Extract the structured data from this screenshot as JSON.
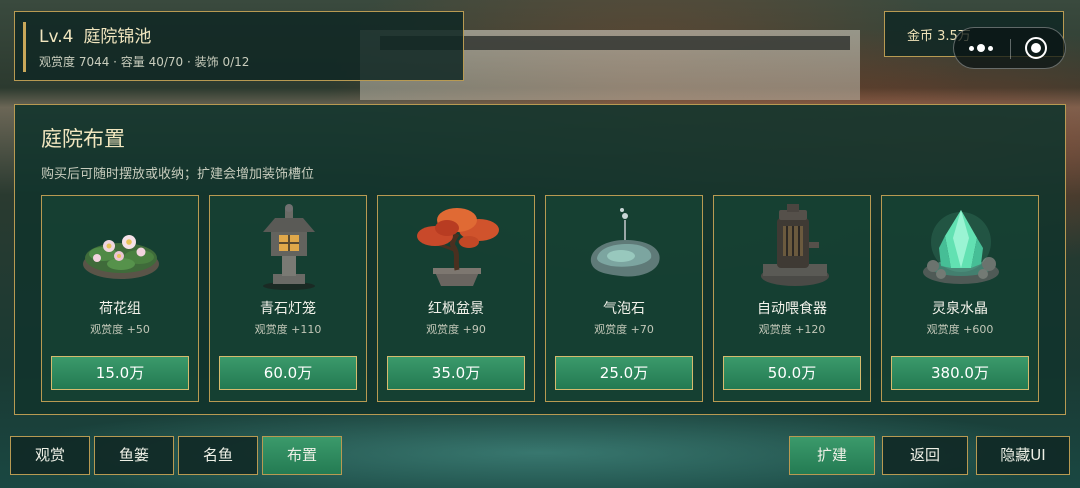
{
  "header": {
    "level": "Lv.4",
    "name": "庭院锦池",
    "stats": "观赏度 7044 · 容量 40/70 · 装饰 0/12"
  },
  "coins": {
    "text": "金币 3.5万"
  },
  "capsule": {
    "more_icon": "more-dots-icon",
    "close_icon": "target-circle-icon"
  },
  "panel": {
    "title": "庭院布置",
    "subtitle": "购买后可随时摆放或收纳；扩建会增加装饰槽位"
  },
  "items": [
    {
      "name": "荷花组",
      "bonus": "观赏度 +50",
      "price": "15.0万",
      "icon": "lotus-cluster-icon"
    },
    {
      "name": "青石灯笼",
      "bonus": "观赏度 +110",
      "price": "60.0万",
      "icon": "stone-lantern-icon"
    },
    {
      "name": "红枫盆景",
      "bonus": "观赏度 +90",
      "price": "35.0万",
      "icon": "maple-bonsai-icon"
    },
    {
      "name": "气泡石",
      "bonus": "观赏度 +70",
      "price": "25.0万",
      "icon": "bubble-stone-icon"
    },
    {
      "name": "自动喂食器",
      "bonus": "观赏度 +120",
      "price": "50.0万",
      "icon": "auto-feeder-icon"
    },
    {
      "name": "灵泉水晶",
      "bonus": "观赏度 +600",
      "price": "380.0万",
      "icon": "spirit-crystal-icon"
    }
  ],
  "bottom_nav": {
    "tabs": [
      "观赏",
      "鱼篓",
      "名鱼",
      "布置"
    ],
    "active_tab": "布置",
    "actions": [
      "扩建",
      "返回",
      "隐藏UI"
    ]
  },
  "colors": {
    "accent_gold": "#b89a52",
    "button_green": "#2f8a5f",
    "panel_bg": "#12342c"
  }
}
